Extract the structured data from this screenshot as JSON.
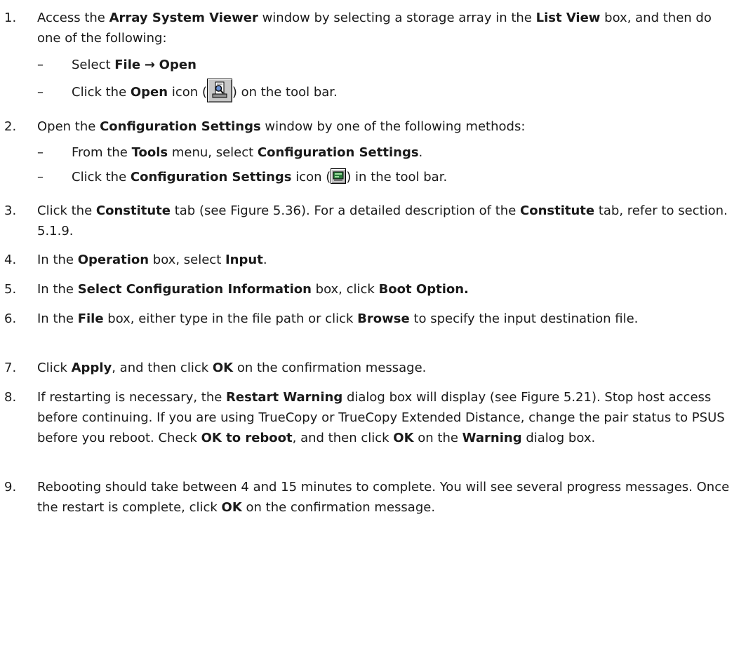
{
  "steps": [
    {
      "num": "1.",
      "parts": [
        {
          "t": "Access the "
        },
        {
          "t": "Array System Viewer",
          "b": true
        },
        {
          "t": " window by selecting a storage array in the "
        },
        {
          "t": "List View",
          "b": true
        },
        {
          "t": " box, and then do one of the following:"
        }
      ]
    },
    {
      "num": "2.",
      "parts": [
        {
          "t": "Open the "
        },
        {
          "t": "Configuration Settings",
          "b": true
        },
        {
          "t": " window by one of the following methods:"
        }
      ]
    },
    {
      "num": "3.",
      "parts": [
        {
          "t": "Click the "
        },
        {
          "t": "Constitute",
          "b": true
        },
        {
          "t": " tab (see Figure 5.36). For a detailed description of the "
        },
        {
          "t": "Constitute",
          "b": true
        },
        {
          "t": " tab, refer to section. 5.1.9."
        }
      ]
    },
    {
      "num": "4.",
      "parts": [
        {
          "t": "In the "
        },
        {
          "t": "Operation",
          "b": true
        },
        {
          "t": " box, select "
        },
        {
          "t": "Input",
          "b": true
        },
        {
          "t": "."
        }
      ]
    },
    {
      "num": "5.",
      "parts": [
        {
          "t": "In the "
        },
        {
          "t": "Select Configuration Information",
          "b": true
        },
        {
          "t": " box, click "
        },
        {
          "t": "Boot Option.",
          "b": true
        }
      ]
    },
    {
      "num": "6.",
      "parts": [
        {
          "t": "In the "
        },
        {
          "t": "File",
          "b": true
        },
        {
          "t": " box, either type in the file path or click "
        },
        {
          "t": "Browse",
          "b": true
        },
        {
          "t": " to specify the input destination file."
        }
      ]
    },
    {
      "num": "7.",
      "parts": [
        {
          "t": "Click "
        },
        {
          "t": "Apply",
          "b": true
        },
        {
          "t": ", and then click "
        },
        {
          "t": "OK",
          "b": true
        },
        {
          "t": " on the confirmation message."
        }
      ]
    },
    {
      "num": "8.",
      "parts": [
        {
          "t": "If restarting is necessary, the "
        },
        {
          "t": "Restart Warning",
          "b": true
        },
        {
          "t": " dialog box will display (see Figure 5.21). Stop host access before continuing. If you are using TrueCopy or TrueCopy Extended Distance, change the pair status to PSUS before you reboot. Check "
        },
        {
          "t": "OK to reboot",
          "b": true
        },
        {
          "t": ", and then click "
        },
        {
          "t": "OK",
          "b": true
        },
        {
          "t": " on the "
        },
        {
          "t": "Warning",
          "b": true
        },
        {
          "t": " dialog box."
        }
      ]
    },
    {
      "num": "9.",
      "parts": [
        {
          "t": "Rebooting should take between 4 and 15 minutes to complete. You will see several progress messages. Once the restart is complete, click "
        },
        {
          "t": "OK",
          "b": true
        },
        {
          "t": " on the confirmation message."
        }
      ]
    }
  ],
  "substeps": {
    "s1a": {
      "dash": "–",
      "select": "Select ",
      "file": "File",
      "arrow": "→",
      "open": "Open"
    },
    "s1b": {
      "dash": "–",
      "click": "Click the ",
      "open": "Open",
      "icon_pre": " icon (",
      "icon": "open-icon",
      "icon_post": ") on the tool bar."
    },
    "s2a": {
      "dash": "–",
      "from": "From the ",
      "tools": "Tools",
      "menu": " menu, select ",
      "cfg": "Configuration Settings",
      "end": "."
    },
    "s2b": {
      "dash": "–",
      "click": "Click the ",
      "cfg": "Configuration Settings",
      "icon_pre": " icon (",
      "icon": "configuration-settings-icon",
      "icon_post": ") in the tool bar."
    }
  }
}
